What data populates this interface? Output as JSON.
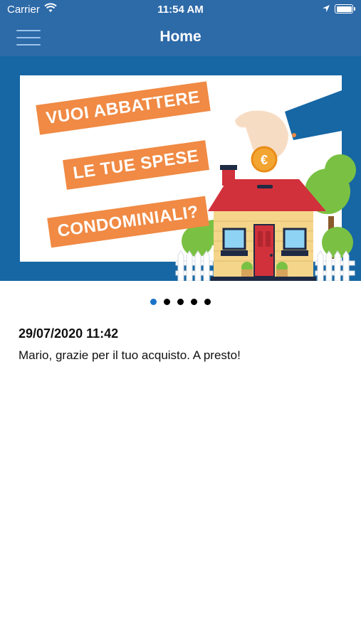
{
  "status_bar": {
    "carrier": "Carrier",
    "time": "11:54 AM"
  },
  "nav": {
    "title": "Home"
  },
  "banner": {
    "lines": [
      "VUOI ABBATTERE",
      "LE TUE SPESE",
      "CONDOMINIALI?"
    ],
    "coin_symbol": "€",
    "colors": {
      "background": "#1667a4",
      "badge": "#f08a44",
      "roof": "#d1313b",
      "house": "#f4d58a"
    }
  },
  "carousel": {
    "dots": [
      true,
      false,
      false,
      false,
      false
    ]
  },
  "message": {
    "date": "29/07/2020 11:42",
    "text": "Mario, grazie per il tuo acquisto. A presto!"
  },
  "colors": {
    "header": "#2d6aa8",
    "active_dot": "#1a73c9"
  }
}
